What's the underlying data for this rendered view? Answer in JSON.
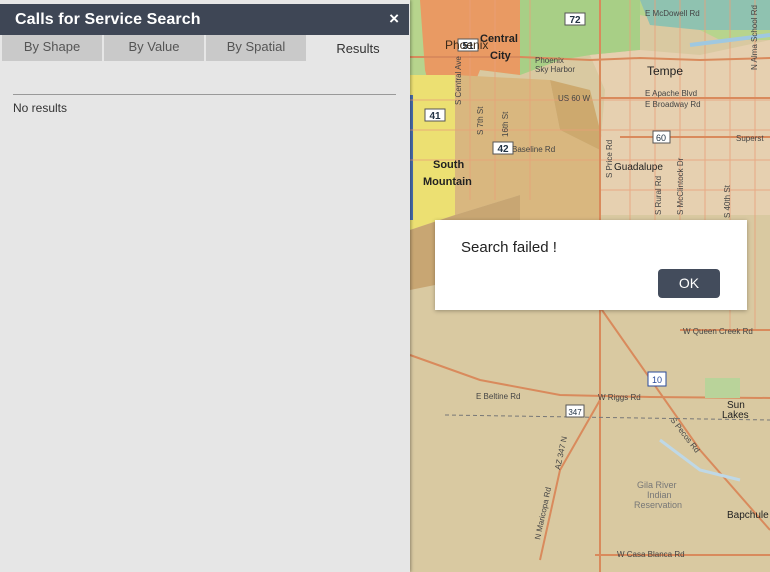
{
  "panel": {
    "title": "Calls for Service Search",
    "close_label": "×",
    "tabs": [
      {
        "label": "By Shape"
      },
      {
        "label": "By Value"
      },
      {
        "label": "By Spatial"
      },
      {
        "label": "Results",
        "active": true
      }
    ],
    "results_text": "No results"
  },
  "dialog": {
    "message": "Search failed !",
    "ok_label": "OK"
  },
  "map": {
    "places": [
      "Phoenix",
      "Central City",
      "South Mountain",
      "Tempe",
      "Guadalupe",
      "Sun Lakes",
      "Bapchule",
      "Gila River Indian Reservation",
      "Sky Harbor International Airport"
    ],
    "roads": [
      "E McDowell Rd",
      "E Apache Blvd",
      "E Broadway Rd",
      "Baseline Rd",
      "US 60 W",
      "Superst",
      "W Queen Creek Rd",
      "E Beltine Rd",
      "W Riggs Rd",
      "W Casa Blanca Rd",
      "S Central Ave",
      "S 7th St",
      "16th St",
      "S Rural Rd",
      "S McClintock Dr",
      "N Alma School Rd",
      "S Price Rd",
      "S 40th St",
      "N Maricopa Rd",
      "AZ 347 N",
      "S Pecos Rd"
    ],
    "shields": [
      "72",
      "51",
      "41",
      "42",
      "60",
      "10",
      "347"
    ]
  }
}
